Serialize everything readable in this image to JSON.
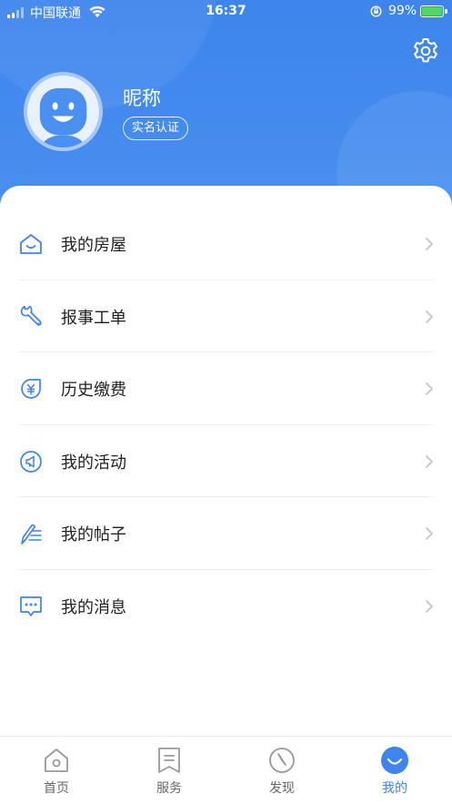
{
  "status_bar": {
    "carrier": "中国联通",
    "time": "16:37",
    "battery": "99%"
  },
  "profile": {
    "nickname": "昵称",
    "verify_label": "实名认证"
  },
  "menu": {
    "items": [
      {
        "label": "我的房屋",
        "icon": "house-icon"
      },
      {
        "label": "报事工单",
        "icon": "wrench-icon"
      },
      {
        "label": "历史缴费",
        "icon": "yen-payment-icon"
      },
      {
        "label": "我的活动",
        "icon": "megaphone-icon"
      },
      {
        "label": "我的帖子",
        "icon": "pen-post-icon"
      },
      {
        "label": "我的消息",
        "icon": "message-icon"
      }
    ]
  },
  "tabbar": {
    "tabs": [
      {
        "label": "首页",
        "icon": "home-icon",
        "active": false
      },
      {
        "label": "服务",
        "icon": "bookmark-icon",
        "active": false
      },
      {
        "label": "发现",
        "icon": "compass-icon",
        "active": false
      },
      {
        "label": "我的",
        "icon": "smile-icon",
        "active": true
      }
    ]
  },
  "colors": {
    "accent": "#3d84ec",
    "header_bg": "#4a90f0",
    "icon_blue": "#3d84ec",
    "inactive_gray": "#999999",
    "battery_green": "#4cd964"
  }
}
